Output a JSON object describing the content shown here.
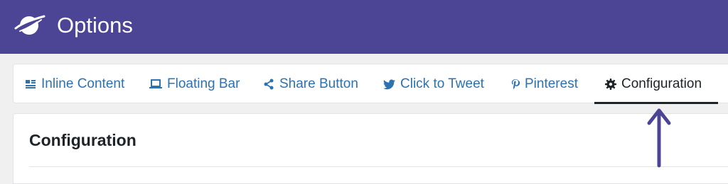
{
  "colors": {
    "header_bg": "#4c4495",
    "link": "#2c72b0",
    "active_text": "#1d2327",
    "active_underline": "#1d2327",
    "arrow": "#4c4495"
  },
  "header": {
    "title": "Options",
    "logo_icon": "planet-swirl-logo"
  },
  "tabs": [
    {
      "label": "Inline Content",
      "icon": "inline-content-icon",
      "active": false
    },
    {
      "label": "Floating Bar",
      "icon": "laptop-icon",
      "active": false
    },
    {
      "label": "Share Button",
      "icon": "share-icon",
      "active": false
    },
    {
      "label": "Click to Tweet",
      "icon": "twitter-bird-icon",
      "active": false
    },
    {
      "label": "Pinterest",
      "icon": "pinterest-icon",
      "active": false
    },
    {
      "label": "Configuration",
      "icon": "gear-icon",
      "active": true
    }
  ],
  "panel": {
    "title": "Configuration"
  },
  "annotation": {
    "icon": "arrow-up-icon"
  }
}
